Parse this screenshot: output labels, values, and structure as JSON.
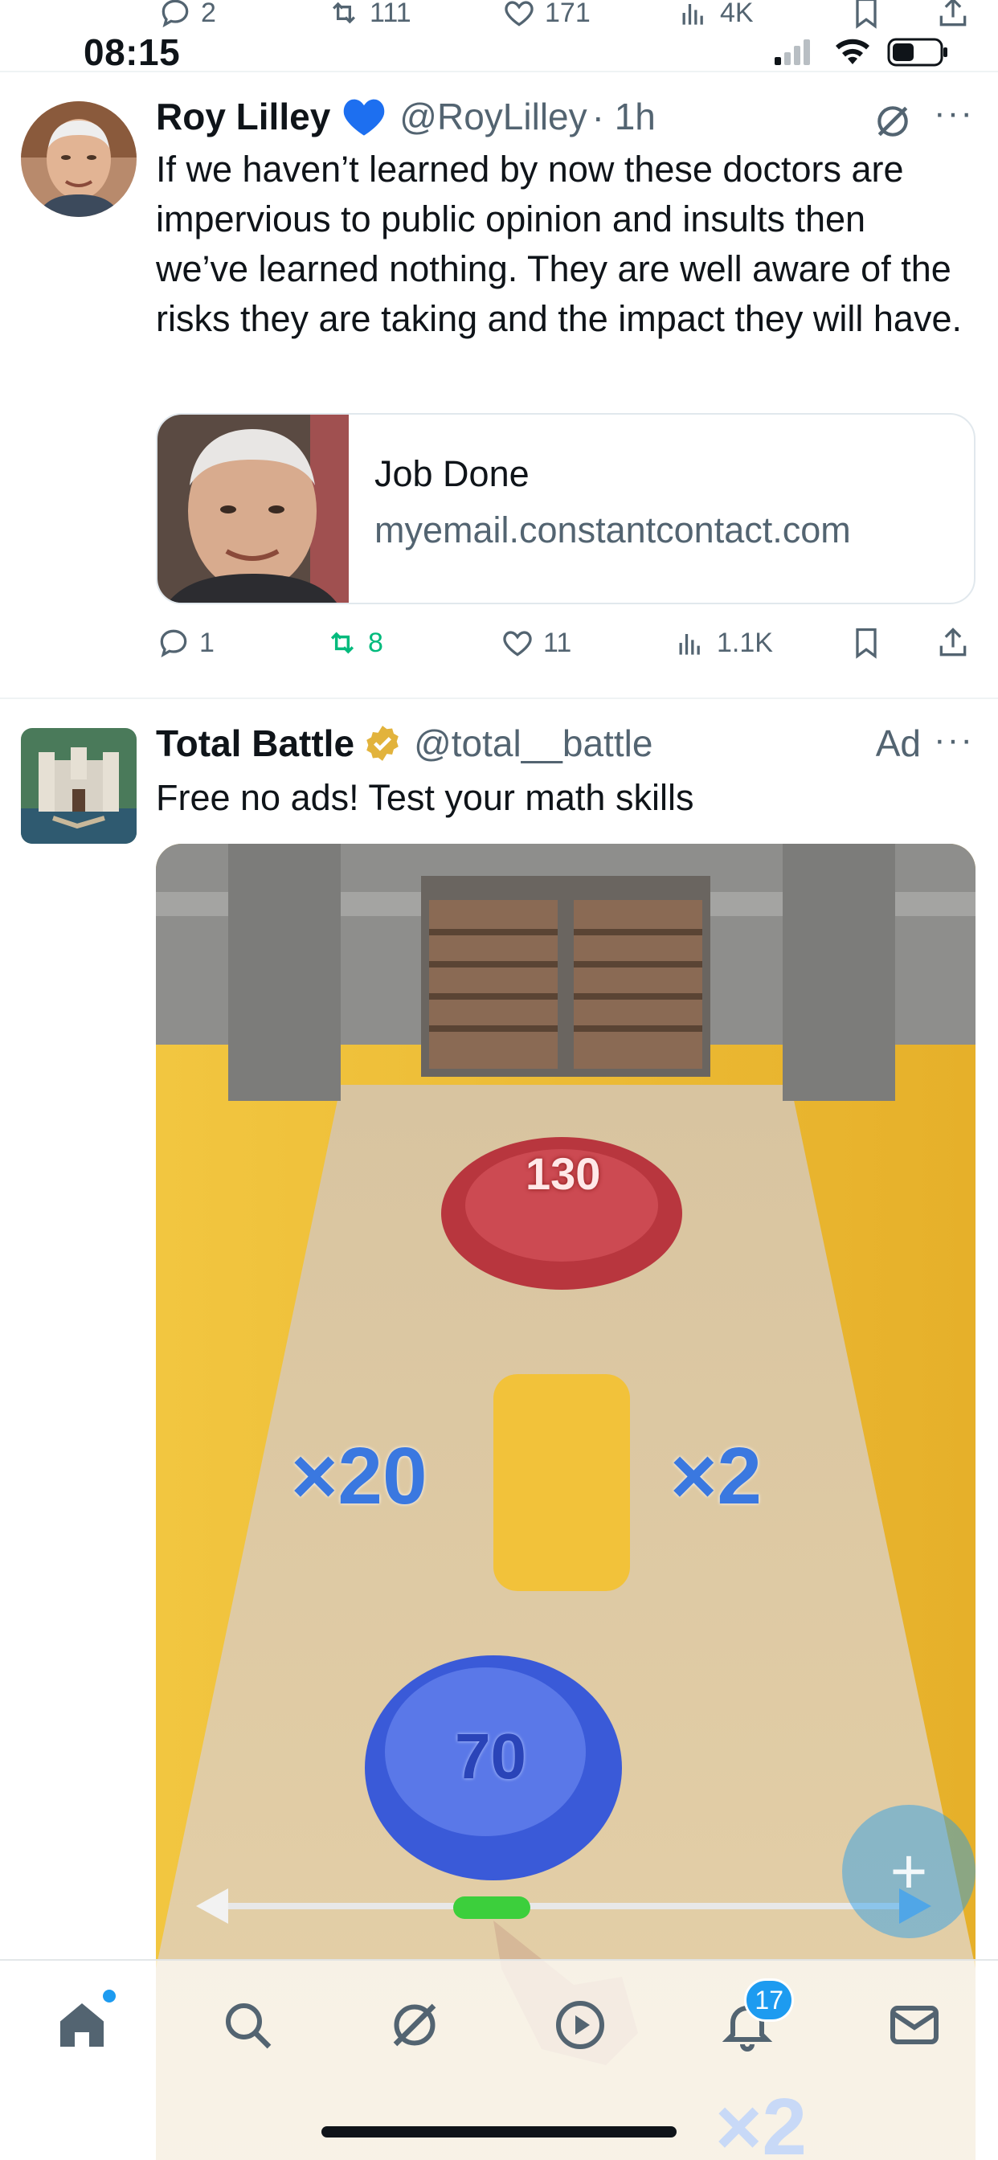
{
  "status_bar": {
    "time": "08:15"
  },
  "prev_tweet": {
    "replies": "2",
    "reposts": "111",
    "likes": "171",
    "views": "4K"
  },
  "tweet1": {
    "name": "Roy Lilley",
    "handle": "@RoyLilley",
    "time": "· 1h",
    "text": "If we haven’t learned by now these doctors are impervious to public opinion and insults then we’ve learned nothing. They are well aware of the risks they are taking and the impact they will have.",
    "card": {
      "title": "Job Done",
      "domain": "myemail.constantcontact.com"
    },
    "replies": "1",
    "reposts": "8",
    "likes": "11",
    "views": "1.1K"
  },
  "tweet2": {
    "name": "Total Battle",
    "handle": "@total__battle",
    "ad_label": "Ad",
    "text": "Free no ads! Test your math skills",
    "media": {
      "enemy_count": "130",
      "gate_left": "×20",
      "gate_right": "×2",
      "player_count": "70",
      "bottom_gate": "×2"
    }
  },
  "nav": {
    "items": [
      "home",
      "search",
      "grok",
      "video",
      "notifications",
      "messages"
    ],
    "notifications_badge": "17"
  },
  "colors": {
    "accent": "#1d9bf0",
    "repost_active": "#00ba7c",
    "muted": "#536471"
  },
  "icons": {
    "reply": "reply-icon",
    "repost": "repost-icon",
    "like": "heart-icon",
    "views": "views-icon",
    "bookmark": "bookmark-icon",
    "share": "share-icon",
    "more": "more-icon",
    "grok": "grok-icon",
    "verified_heart": "blue-heart-icon",
    "verified_gold": "gold-check-icon",
    "compose": "plus-icon"
  },
  "fab": {
    "label": "+"
  }
}
